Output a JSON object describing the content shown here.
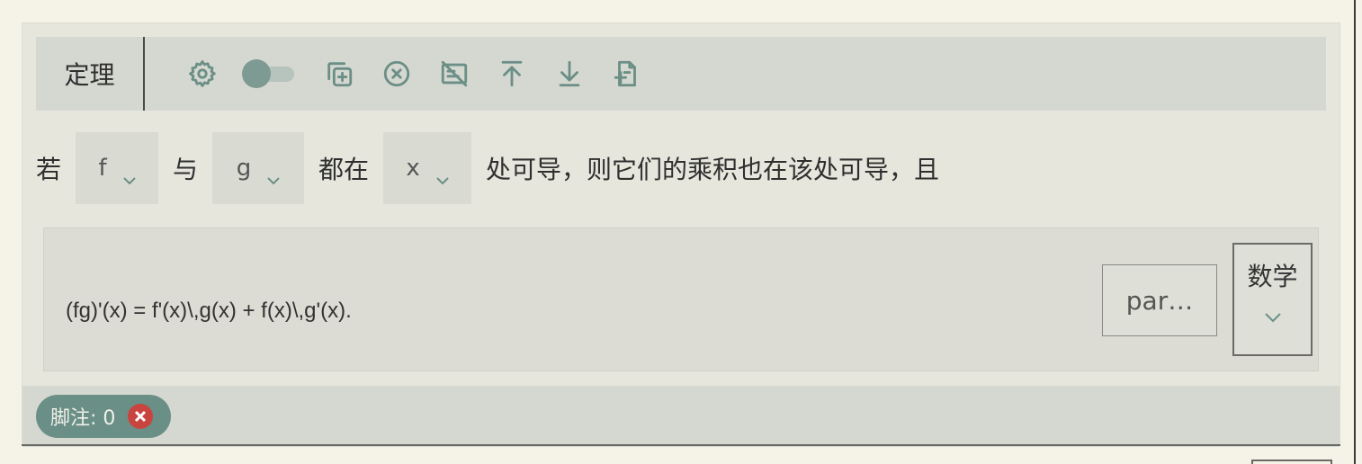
{
  "block": {
    "title": "定理",
    "toolbar_icons": [
      "gear-icon",
      "toggle",
      "duplicate-icon",
      "remove-icon",
      "hide-caption-icon",
      "move-up-icon",
      "move-down-icon",
      "insert-file-icon"
    ],
    "toggle_on": false
  },
  "sentence": {
    "part1": "若",
    "select1": "f",
    "part2": "与",
    "select2": "g",
    "part3": "都在",
    "select3": "x",
    "part4": "处可导，则它们的乘积也在该处可导，且"
  },
  "formula": {
    "source": "(fg)'(x) = f'(x)\\,g(x) + f(x)\\,g'(x).",
    "par_label": "par…",
    "type_label": "数学"
  },
  "footnote": {
    "label": "脚注: 0"
  },
  "colors": {
    "accent": "#6a8f86",
    "close": "#c9443f",
    "toolbar_bg": "#d5d8d1"
  }
}
